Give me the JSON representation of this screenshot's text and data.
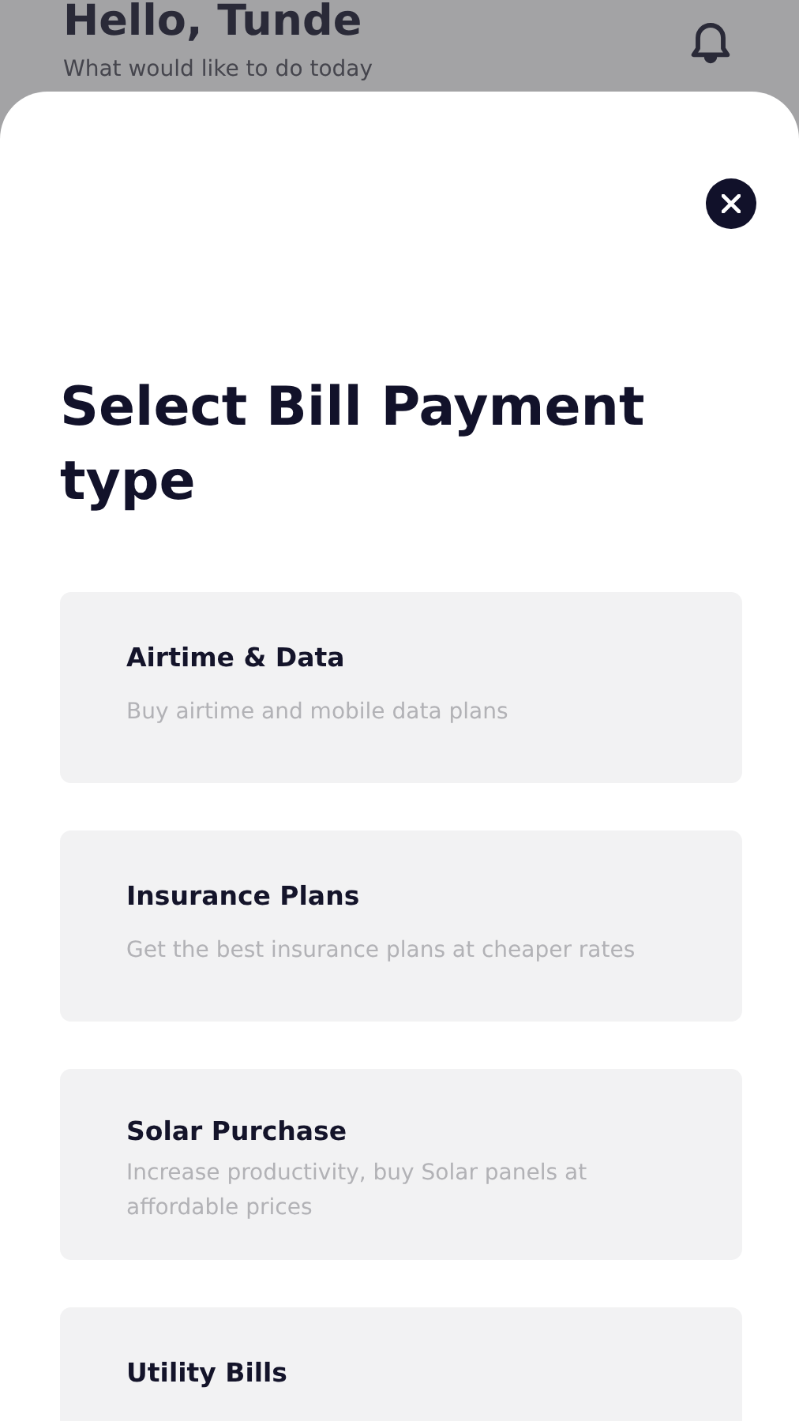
{
  "background": {
    "greeting": "Hello, Tunde",
    "subtitle": "What would like to do today"
  },
  "sheet": {
    "title": "Select Bill Payment type",
    "options": [
      {
        "title": "Airtime & Data",
        "description": "Buy airtime and mobile data plans"
      },
      {
        "title": "Insurance Plans",
        "description": "Get the best insurance plans at cheaper rates"
      },
      {
        "title": "Solar Purchase",
        "description": "Increase productivity, buy Solar panels at affordable prices"
      },
      {
        "title": "Utility Bills"
      }
    ]
  }
}
